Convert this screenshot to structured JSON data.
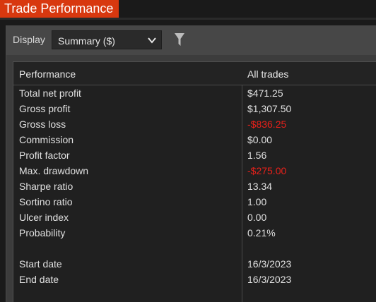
{
  "window": {
    "title": "Trade Performance",
    "accent": "#d8380f"
  },
  "toolbar": {
    "display_label": "Display",
    "display_select": {
      "value": "Summary ($)"
    },
    "filter_icon": "filter-icon"
  },
  "table": {
    "headers": {
      "col1": "Performance",
      "col2": "All trades"
    },
    "rows": [
      {
        "label": "Total net profit",
        "value": "$471.25",
        "negative": false
      },
      {
        "label": "Gross profit",
        "value": "$1,307.50",
        "negative": false
      },
      {
        "label": "Gross loss",
        "value": "-$836.25",
        "negative": true
      },
      {
        "label": "Commission",
        "value": "$0.00",
        "negative": false
      },
      {
        "label": "Profit factor",
        "value": "1.56",
        "negative": false
      },
      {
        "label": "Max. drawdown",
        "value": "-$275.00",
        "negative": true
      },
      {
        "label": "Sharpe ratio",
        "value": "13.34",
        "negative": false
      },
      {
        "label": "Sortino ratio",
        "value": "1.00",
        "negative": false
      },
      {
        "label": "Ulcer index",
        "value": "0.00",
        "negative": false
      },
      {
        "label": "Probability",
        "value": "0.21%",
        "negative": false
      },
      {
        "label": "",
        "value": "",
        "negative": false
      },
      {
        "label": "Start date",
        "value": "16/3/2023",
        "negative": false
      },
      {
        "label": "End date",
        "value": "16/3/2023",
        "negative": false
      }
    ],
    "negative_color": "#e8201a"
  }
}
